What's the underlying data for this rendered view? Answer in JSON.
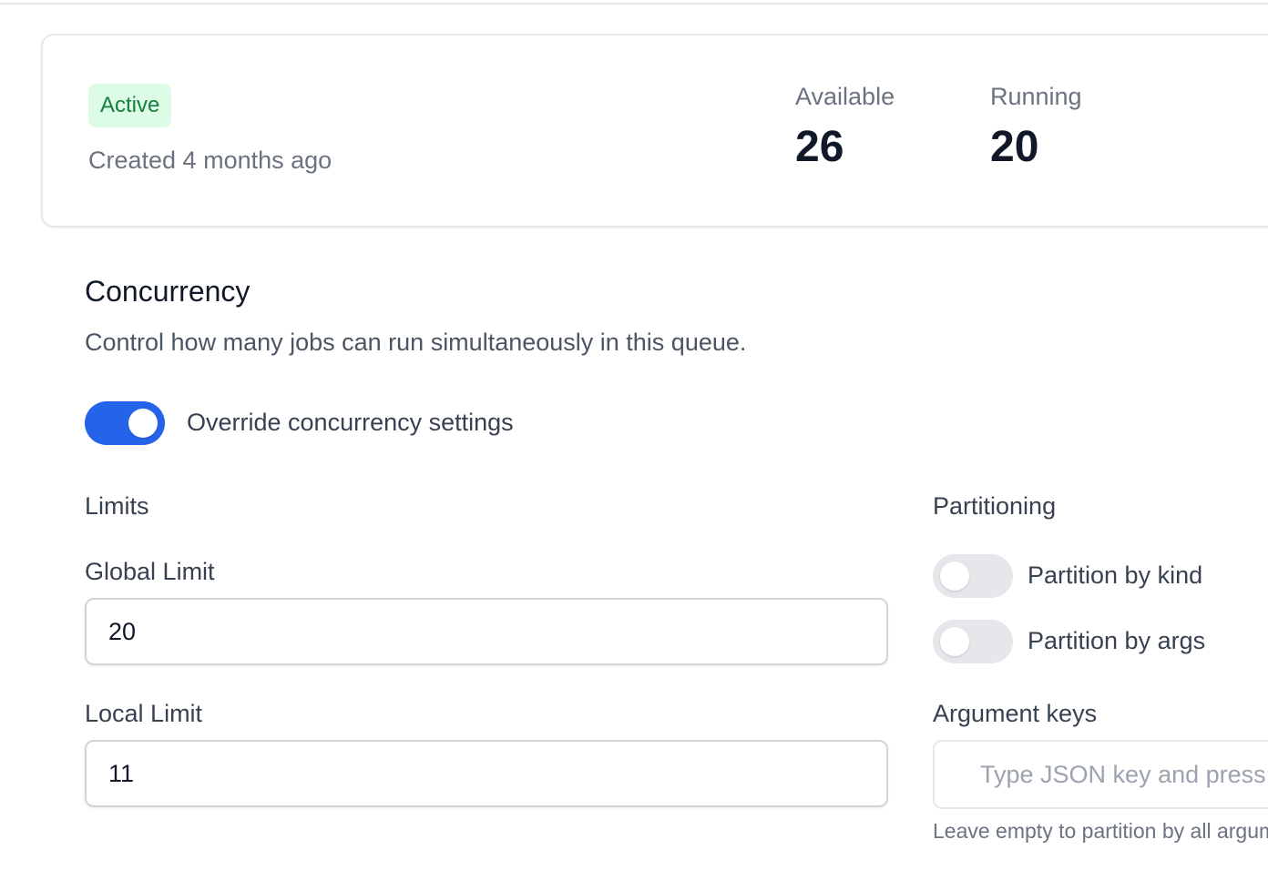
{
  "summary": {
    "status_badge": "Active",
    "created": "Created 4 months ago",
    "stats": [
      {
        "label": "Available",
        "value": "26"
      },
      {
        "label": "Running",
        "value": "20"
      }
    ]
  },
  "concurrency": {
    "title": "Concurrency",
    "description": "Control how many jobs can run simultaneously in this queue.",
    "override_toggle": {
      "label": "Override concurrency settings",
      "on": true
    },
    "limits": {
      "heading": "Limits",
      "global_label": "Global Limit",
      "global_value": "20",
      "local_label": "Local Limit",
      "local_value": "11"
    },
    "partitioning": {
      "heading": "Partitioning",
      "by_kind": {
        "label": "Partition by kind",
        "on": false
      },
      "by_args": {
        "label": "Partition by args",
        "on": false
      },
      "argument_keys_label": "Argument keys",
      "argument_keys_placeholder": "Type JSON key and press Enter",
      "argument_keys_hint": "Leave empty to partition by all arguments"
    }
  },
  "colors": {
    "accent": "#2563eb",
    "badge_bg": "#dcfce7",
    "badge_text": "#15803d",
    "toggle_off": "#e5e7eb"
  }
}
